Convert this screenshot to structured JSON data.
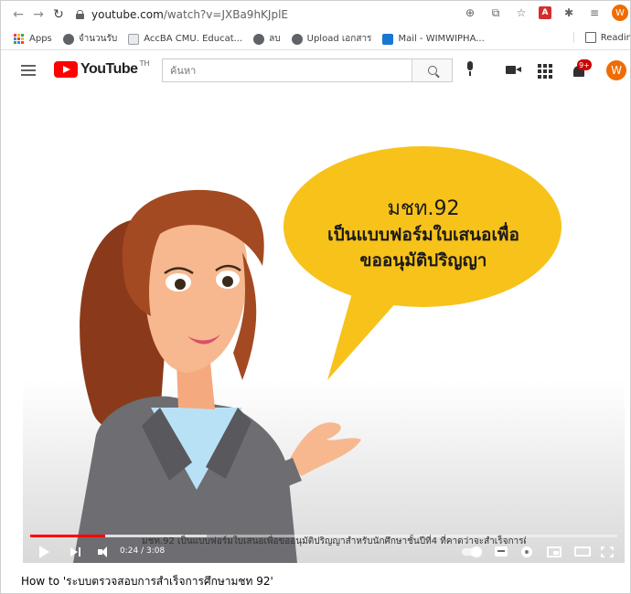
{
  "browser": {
    "url_domain": "youtube.com",
    "url_path": "/watch?v=JXBa9hKJplE",
    "profile_initial": "W"
  },
  "bookmarks": {
    "items": [
      {
        "label": "Apps",
        "icon": "apps-grid-icon"
      },
      {
        "label": "จำนวนรับ",
        "icon": "globe-icon"
      },
      {
        "label": "AccBA CMU. Educat...",
        "icon": "page-icon"
      },
      {
        "label": "ลบ",
        "icon": "globe-icon"
      },
      {
        "label": "Upload เอกสาร",
        "icon": "globe-icon"
      },
      {
        "label": "Mail - WIMWIPHA...",
        "icon": "outlook-icon"
      }
    ],
    "reading_list": "Readin"
  },
  "youtube": {
    "logo_text": "YouTube",
    "region": "TH",
    "search_placeholder": "ค้นหา",
    "notification_count": "9+",
    "avatar_initial": "W"
  },
  "player": {
    "bubble_line1": "มชท.92",
    "bubble_line2": "เป็นแบบฟอร์มใบเสนอเพื่อ",
    "bubble_line3": "ขออนุมัติปริญญา",
    "subtitle": "มชท.92 เป็นแบบฟอร์มใบเสนอเพื่อขออนุมัติปริญญาสำหรับนักศึกษาชั้นปีที่4 ที่คาดว่าจะสำเร็จการศึกษา",
    "time": "0:24 / 3:08",
    "progress_fraction": 0.127,
    "loaded_fraction": 0.3
  },
  "video": {
    "title": "How to 'ระบบตรวจสอบการสำเร็จการศึกษามชท 92'"
  },
  "colors": {
    "youtube_red": "#ff0000",
    "bubble_yellow": "#f7c21a",
    "avatar_orange": "#ef6c00"
  }
}
